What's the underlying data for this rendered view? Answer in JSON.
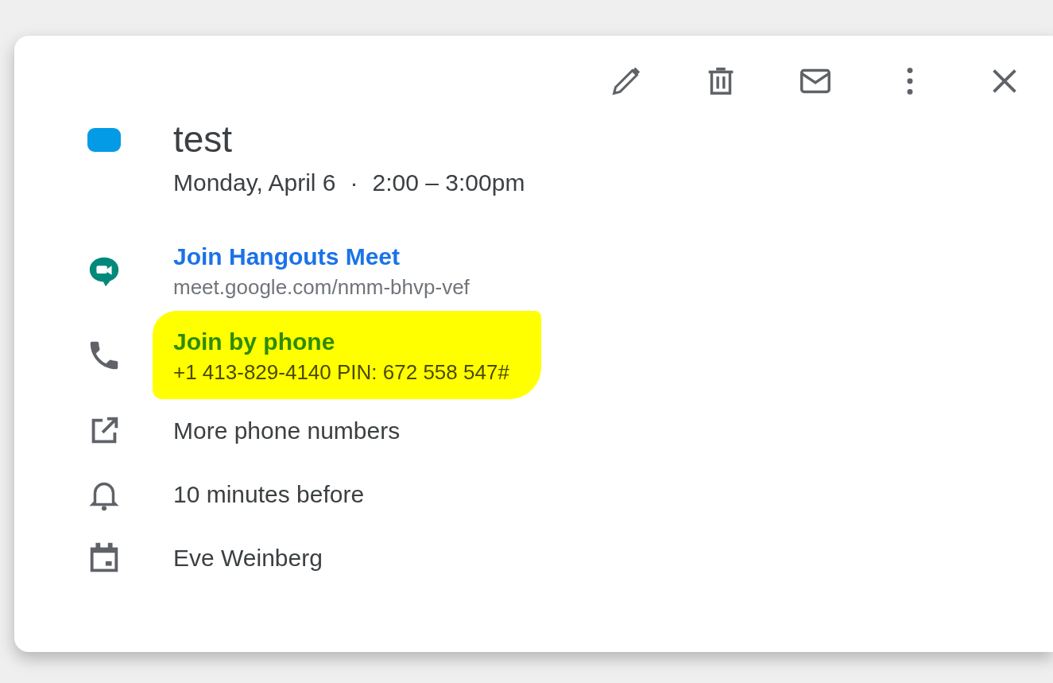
{
  "event": {
    "title": "test",
    "color": "#039be5",
    "date": "Monday, April 6",
    "separator": "·",
    "time": "2:00 – 3:00pm"
  },
  "details": [
    {
      "kind": "meet",
      "link": "Join Hangouts Meet",
      "subtext": "meet.google.com/nmm-bhvp-vef",
      "highlighted": false
    },
    {
      "kind": "phone",
      "link": "Join by phone",
      "subtext": "+1 413-829-4140 PIN: 672 558 547#",
      "highlighted": true
    },
    {
      "kind": "more-numbers",
      "text": "More phone numbers"
    },
    {
      "kind": "reminder",
      "text": "10 minutes before"
    },
    {
      "kind": "calendar",
      "text": "Eve Weinberg"
    }
  ]
}
